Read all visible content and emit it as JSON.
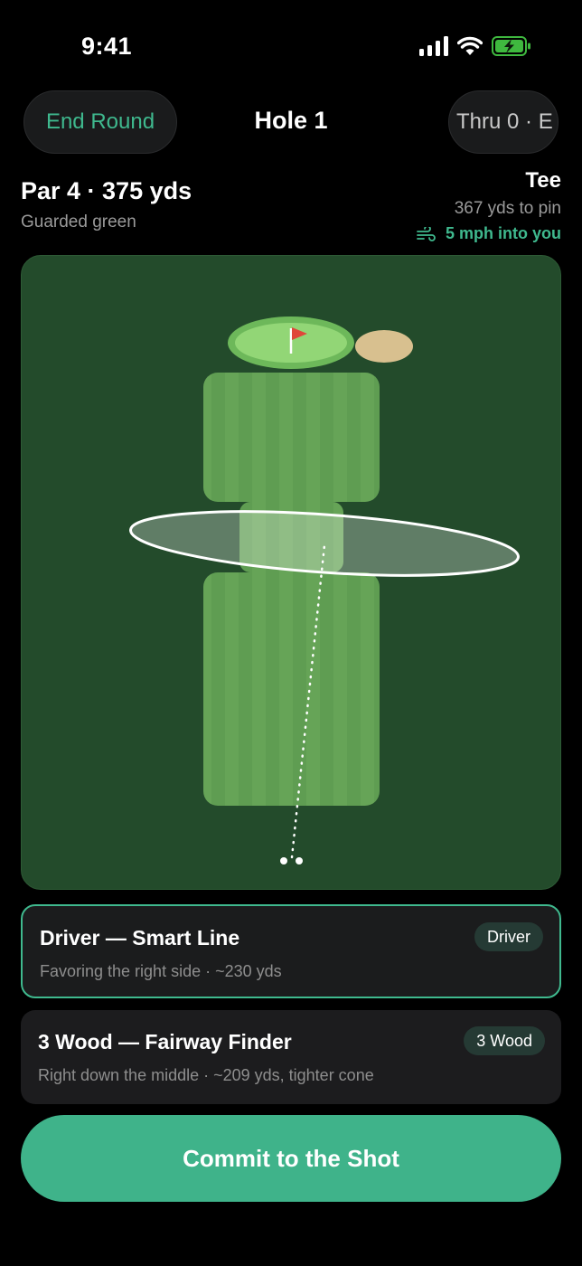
{
  "status_bar": {
    "time": "9:41",
    "icons": [
      "signal-icon",
      "wifi-icon",
      "battery-charging-icon"
    ]
  },
  "header": {
    "end_round_label": "End Round",
    "title": "Hole 1",
    "thru_label": "Thru 0 · E"
  },
  "hole": {
    "par_line": "Par 4 · 375 yds",
    "hazard": "Guarded green",
    "position_label": "Tee",
    "distance_to_pin": "367 yds to pin",
    "wind": "5 mph into you",
    "wind_icon": "wind-icon"
  },
  "shots": [
    {
      "title": "Driver — Smart Line",
      "subtitle": "Favoring the right side · ~230 yds",
      "badge": "Driver",
      "selected": true
    },
    {
      "title": "3 Wood — Fairway Finder",
      "subtitle": "Right down the middle · ~209 yds, tighter cone",
      "badge": "3 Wood",
      "selected": false
    }
  ],
  "commit_label": "Commit to the Shot",
  "colors": {
    "accent": "#3fb98e",
    "map_background": "#234b2b",
    "fairway": "#5e9c50",
    "green": "#8fd46f",
    "bunker": "#d8c08f",
    "flag": "#e0463a"
  }
}
